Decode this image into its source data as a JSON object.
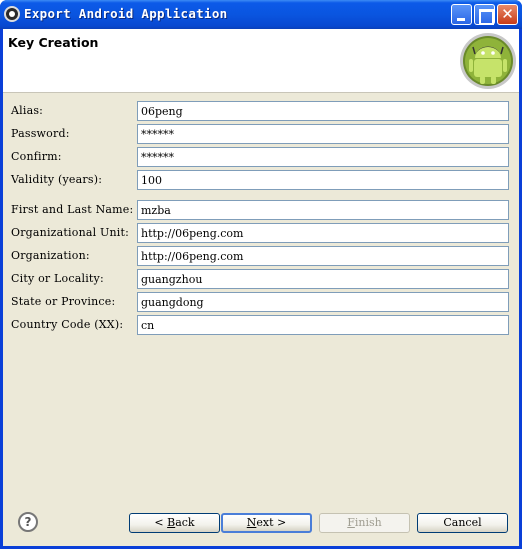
{
  "window": {
    "title": "Export Android Application"
  },
  "header": {
    "title": "Key Creation"
  },
  "form": {
    "fields": [
      {
        "label": "Alias:",
        "value": "06peng"
      },
      {
        "label": "Password:",
        "value": "******"
      },
      {
        "label": "Confirm:",
        "value": "******"
      },
      {
        "label": "Validity (years):",
        "value": "100"
      },
      {
        "label": "First and Last Name:",
        "value": "mzba"
      },
      {
        "label": "Organizational Unit:",
        "value": "http://06peng.com"
      },
      {
        "label": "Organization:",
        "value": "http://06peng.com"
      },
      {
        "label": "City or Locality:",
        "value": "guangzhou"
      },
      {
        "label": "State or Province:",
        "value": "guangdong"
      },
      {
        "label": "Country Code (XX):",
        "value": "cn"
      }
    ]
  },
  "footer": {
    "help_label": "?",
    "back": {
      "mnemonic": "B",
      "rest": "ack",
      "prefix": "< "
    },
    "next": {
      "mnemonic": "N",
      "rest": "ext",
      "suffix": " >"
    },
    "finish": {
      "mnemonic": "F",
      "rest": "inish"
    },
    "cancel_label": "Cancel"
  },
  "colors": {
    "title_bar": "#0a55e0",
    "android_green": "#a4c639",
    "dialog_bg": "#ece9d8"
  }
}
